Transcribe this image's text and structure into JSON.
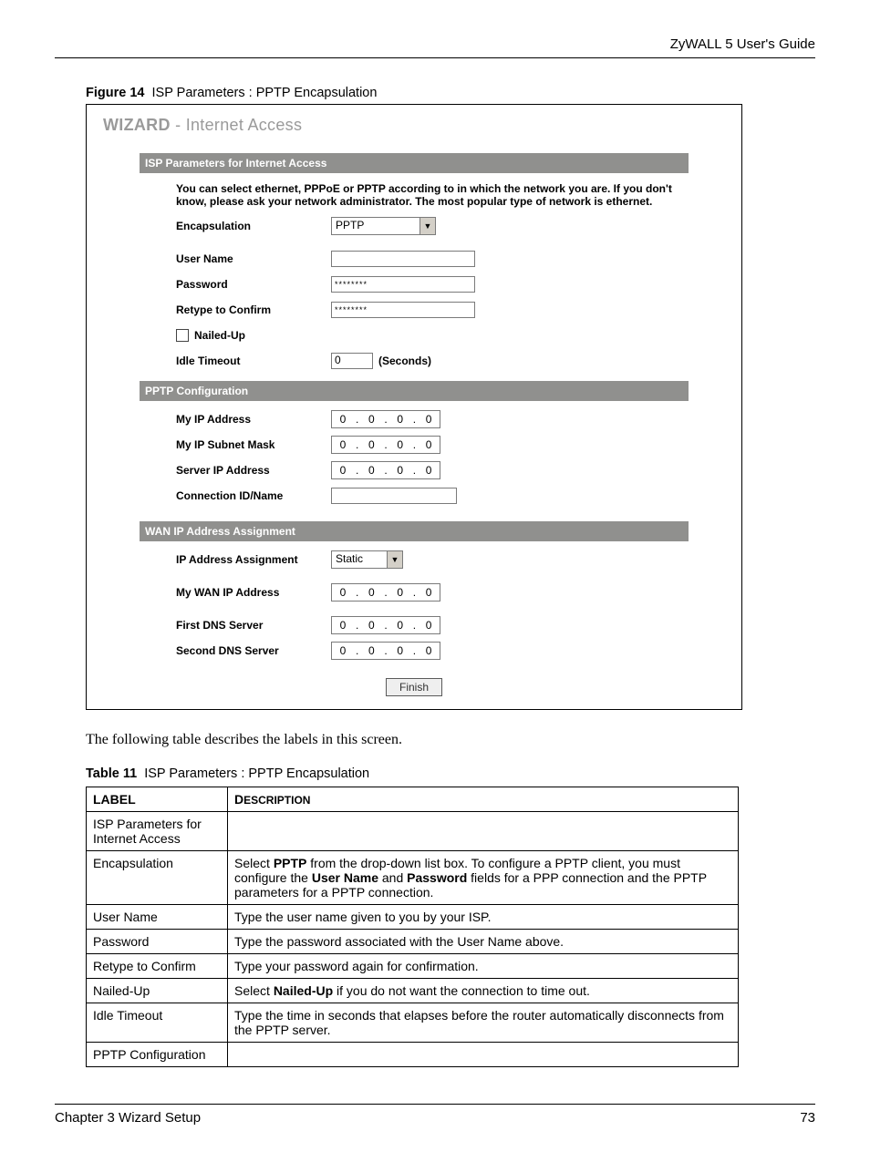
{
  "header": {
    "guide_title": "ZyWALL 5 User's Guide"
  },
  "figure": {
    "label": "Figure 14",
    "title": "ISP Parameters : PPTP Encapsulation"
  },
  "wizard": {
    "title_bold": "WIZARD",
    "title_rest": " - Internet Access",
    "sections": {
      "isp_bar": "ISP Parameters for Internet Access",
      "intro": "You can select ethernet, PPPoE or PPTP according to in which the network you are. If you don't know, please ask your network administrator. The most popular type of network is ethernet.",
      "encapsulation_label": "Encapsulation",
      "encapsulation_value": "PPTP",
      "username_label": "User Name",
      "username_value": "",
      "password_label": "Password",
      "password_value": "********",
      "retype_label": "Retype to Confirm",
      "retype_value": "********",
      "nailed_label": "Nailed-Up",
      "idle_label": "Idle Timeout",
      "idle_value": "0",
      "idle_unit": "(Seconds)",
      "pptp_bar": "PPTP Configuration",
      "myip_label": "My IP Address",
      "myip": [
        "0",
        "0",
        "0",
        "0"
      ],
      "mymask_label": "My IP Subnet Mask",
      "mymask": [
        "0",
        "0",
        "0",
        "0"
      ],
      "serverip_label": "Server IP Address",
      "serverip": [
        "0",
        "0",
        "0",
        "0"
      ],
      "conn_label": "Connection ID/Name",
      "conn_value": "",
      "wan_bar": "WAN IP Address Assignment",
      "ipassign_label": "IP Address Assignment",
      "ipassign_value": "Static",
      "mywan_label": "My WAN IP Address",
      "mywan": [
        "0",
        "0",
        "0",
        "0"
      ],
      "dns1_label": "First DNS Server",
      "dns1": [
        "0",
        "0",
        "0",
        "0"
      ],
      "dns2_label": "Second DNS Server",
      "dns2": [
        "0",
        "0",
        "0",
        "0"
      ]
    },
    "finish_btn": "Finish"
  },
  "body_text": "The following table describes the labels in this screen.",
  "table_caption": {
    "label": "Table 11",
    "title": "ISP Parameters : PPTP Encapsulation"
  },
  "table": {
    "head_label": "LABEL",
    "head_desc_d": "D",
    "head_desc_rest": "ESCRIPTION",
    "rows": [
      {
        "label": "ISP Parameters for Internet Access",
        "desc": ""
      },
      {
        "label": "Encapsulation",
        "desc_parts": [
          "Select ",
          "PPTP",
          " from the drop-down list box. To configure a PPTP client, you must configure the ",
          "User Name",
          " and ",
          "Password",
          " fields for a PPP connection and the PPTP parameters for a PPTP connection."
        ]
      },
      {
        "label": "User Name",
        "desc": "Type the user name given to you by your ISP."
      },
      {
        "label": "Password",
        "desc": "Type the password associated with the User Name above."
      },
      {
        "label": "Retype to Confirm",
        "desc": "Type your password again for confirmation."
      },
      {
        "label": "Nailed-Up",
        "desc_parts": [
          "Select ",
          "Nailed-Up",
          " if you do not want the connection to time out."
        ]
      },
      {
        "label": "Idle Timeout",
        "desc": "Type the time in seconds that elapses before the router automatically disconnects from the PPTP server."
      },
      {
        "label": "PPTP Configuration",
        "desc": ""
      }
    ]
  },
  "footer": {
    "chapter": "Chapter 3 Wizard Setup",
    "page": "73"
  }
}
